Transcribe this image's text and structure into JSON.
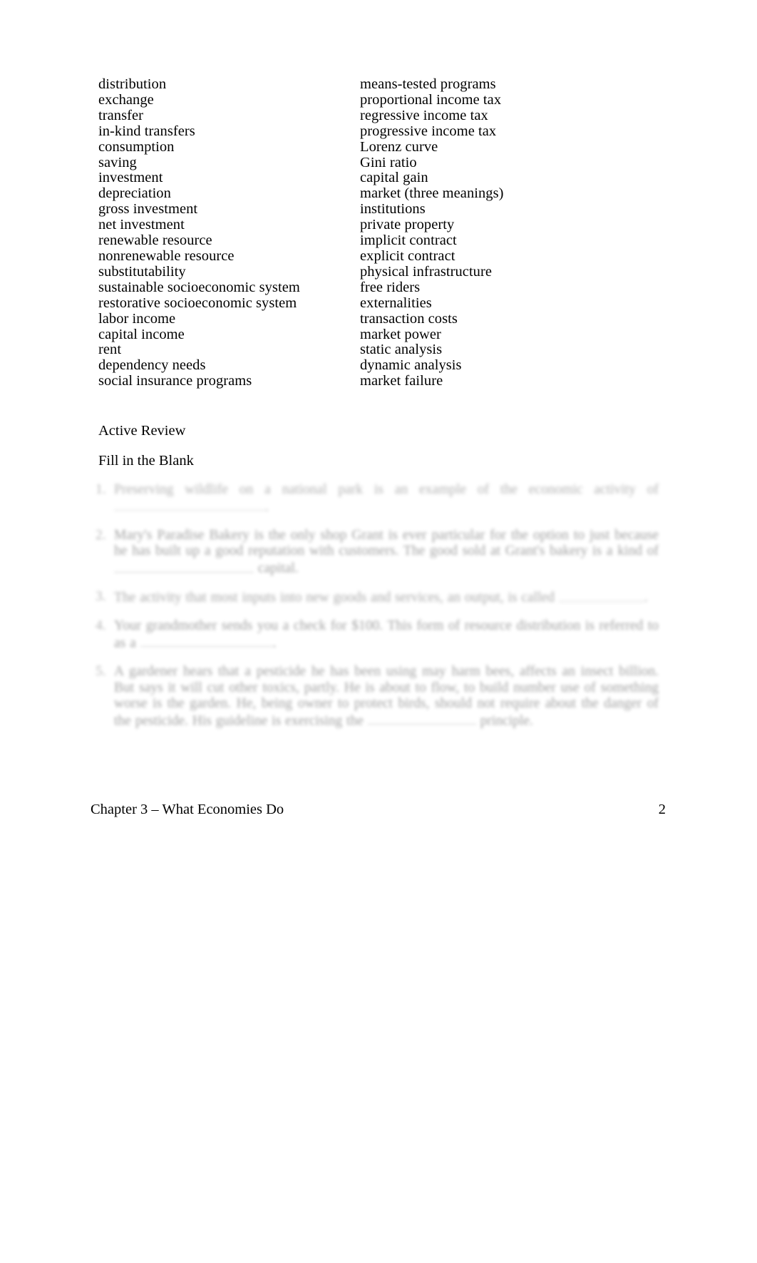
{
  "document": {
    "key_terms": {
      "left_column": [
        "distribution",
        "exchange",
        "transfer",
        "in-kind transfers",
        "consumption",
        "saving",
        "investment",
        "depreciation",
        "gross investment",
        "net investment",
        "renewable resource",
        "nonrenewable resource",
        "substitutability",
        "sustainable socioeconomic system",
        "restorative socioeconomic system",
        "labor income",
        "capital income",
        "rent",
        "dependency needs",
        "social insurance programs"
      ],
      "right_column": [
        "means-tested programs",
        "proportional income tax",
        "regressive income tax",
        "progressive income tax",
        "Lorenz curve",
        "Gini ratio",
        "capital gain",
        "market (three meanings)",
        "institutions",
        "private property",
        "implicit contract",
        "explicit contract",
        "physical infrastructure",
        "free riders",
        "externalities",
        "transaction costs",
        "market power",
        "static analysis",
        "dynamic analysis",
        "market failure"
      ]
    },
    "sections": {
      "active_review": "Active Review",
      "fill_in_the_blank": "Fill in the Blank"
    },
    "questions": [
      {
        "number": "1.",
        "text_part_1": "Preserving wildlife on a national park is an example of the economic activity of",
        "text_part_2": "."
      },
      {
        "number": "2.",
        "text_part_1": "Mary's Paradise Bakery is the only shop Grant is ever particular for the option to just because he has built up a good reputation with customers. The good sold at Grant's bakery is a kind of",
        "text_part_2": "capital."
      },
      {
        "number": "3.",
        "text_part_1": "The activity that most inputs into new goods and services, an output, is called",
        "text_part_2": "."
      },
      {
        "number": "4.",
        "text_part_1": "Your grandmother sends you a check for $100. This form of resource distribution is referred to as a",
        "text_part_2": "."
      },
      {
        "number": "5.",
        "text_part_1": "A gardener hears that a pesticide he has been using may harm bees, affects an insect billion. But says it will cut other toxics, partly. He is about to flow, to build number use of something worse is the garden. He, being owner to protect birds, should not require about the danger of the pesticide. His guideline is exercising the",
        "text_part_2": "principle."
      }
    ],
    "footer": {
      "chapter_title": "Chapter 3 – What Economies Do",
      "page_number": "2"
    }
  }
}
